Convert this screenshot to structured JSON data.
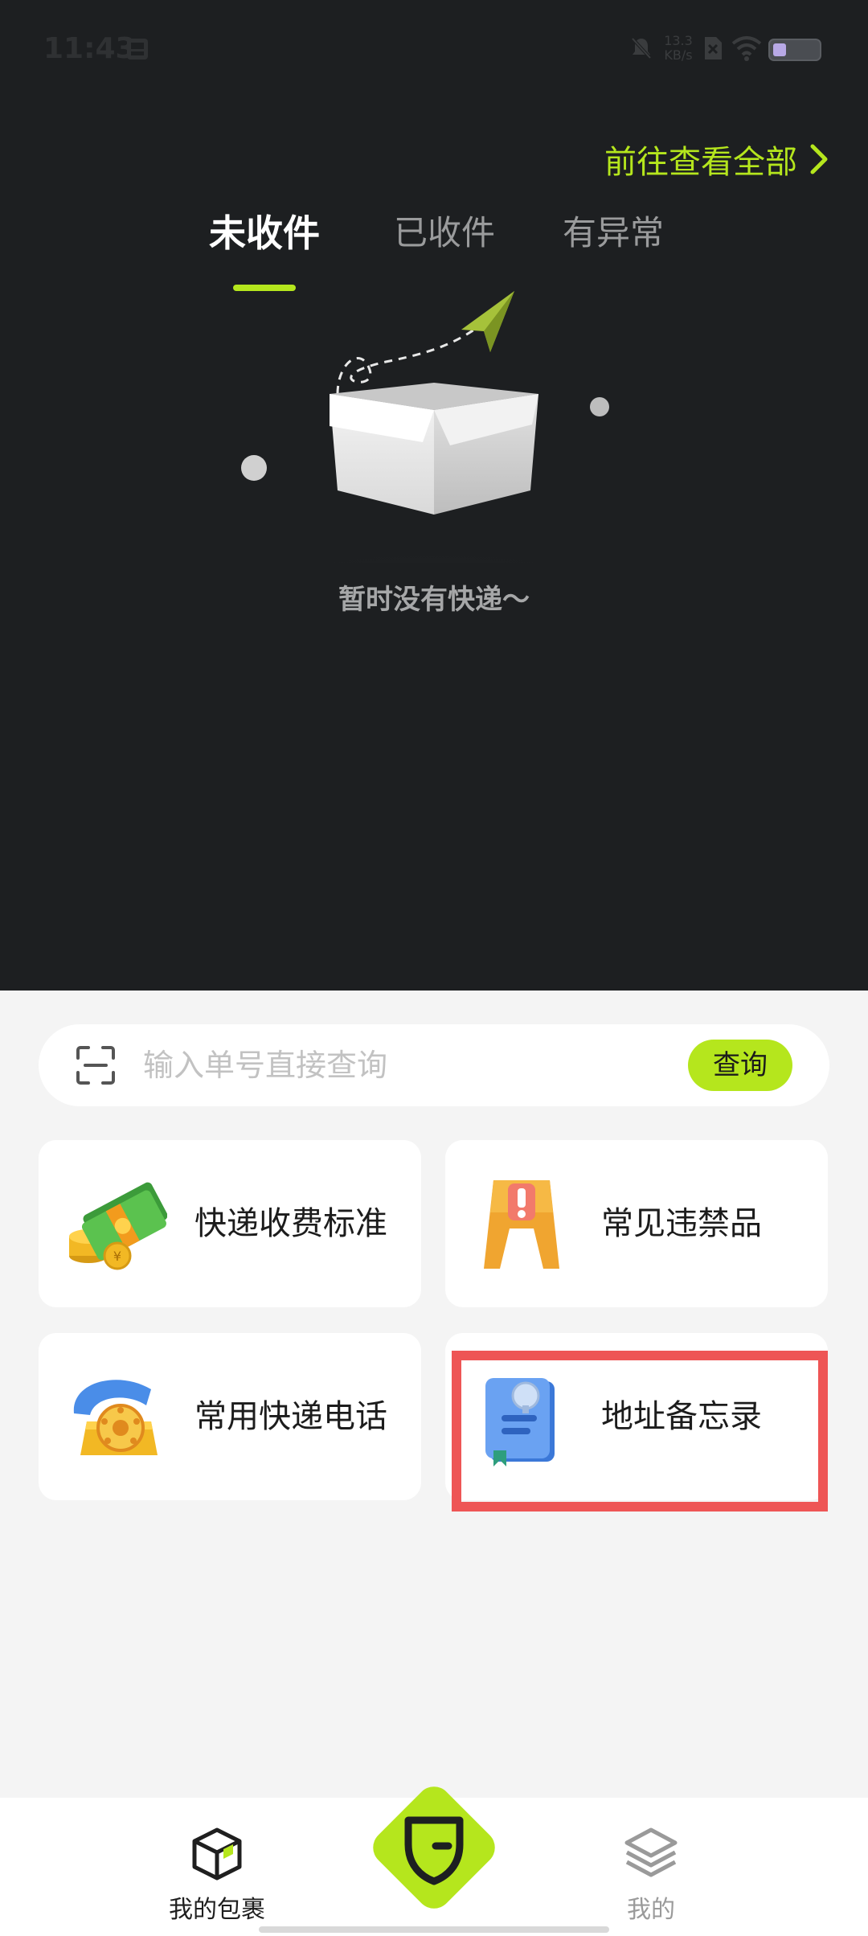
{
  "status_bar": {
    "time": "11:43",
    "net_speed_value": "13.3",
    "net_speed_unit": "KB/s"
  },
  "header": {
    "view_all_label": "前往查看全部"
  },
  "tabs": [
    {
      "label": "未收件",
      "active": true
    },
    {
      "label": "已收件",
      "active": false
    },
    {
      "label": "有异常",
      "active": false
    }
  ],
  "empty_state": {
    "message": "暂时没有快递～"
  },
  "search": {
    "placeholder": "输入单号直接查询",
    "button_label": "查询"
  },
  "cards": [
    {
      "label": "快递收费标准",
      "icon": "money-icon"
    },
    {
      "label": "常见违禁品",
      "icon": "warning-sign-icon"
    },
    {
      "label": "常用快递电话",
      "icon": "telephone-icon"
    },
    {
      "label": "地址备忘录",
      "icon": "address-book-icon"
    }
  ],
  "bottom_nav": [
    {
      "label": "我的包裹",
      "icon": "package-icon",
      "active": true
    },
    {
      "label": "我的",
      "icon": "layers-icon",
      "active": false
    }
  ],
  "colors": {
    "accent": "#b5e61d",
    "dark_bg": "#1d1f21",
    "light_bg": "#f4f4f4",
    "highlight": "#ee5555"
  }
}
